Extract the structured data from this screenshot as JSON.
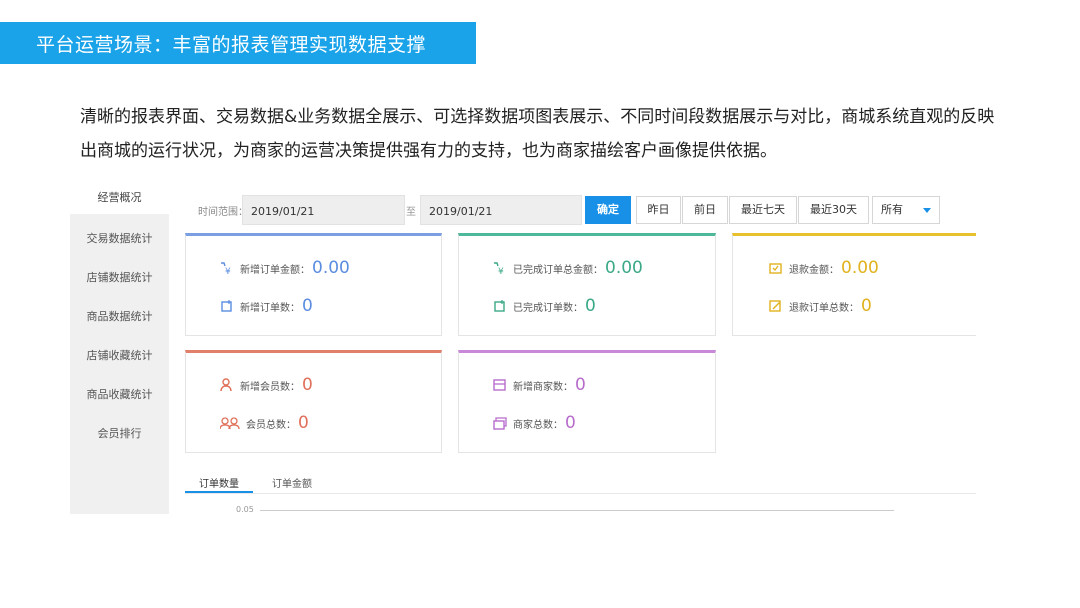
{
  "slide": {
    "title": "平台运营场景：丰富的报表管理实现数据支撑",
    "intro": "清晰的报表界面、交易数据&业务数据全展示、可选择数据项图表展示、不同时间段数据展示与对比，商城系统直观的反映出商城的运行状况，为商家的运营决策提供强有力的支持，也为商家描绘客户画像提供依据。"
  },
  "sidebar": {
    "items": [
      {
        "label": "经营概况"
      },
      {
        "label": "交易数据统计"
      },
      {
        "label": "店铺数据统计"
      },
      {
        "label": "商品数据统计"
      },
      {
        "label": "店铺收藏统计"
      },
      {
        "label": "商品收藏统计"
      },
      {
        "label": "会员排行"
      }
    ]
  },
  "filter": {
    "range_label": "时间范围：",
    "start_date": "2019/01/21",
    "to_label": "至",
    "end_date": "2019/01/21",
    "confirm": "确定",
    "buttons": [
      "昨日",
      "前日",
      "最近七天",
      "最近30天"
    ],
    "select_value": "所有"
  },
  "cards": [
    {
      "color": "#7b9fe0",
      "rows": [
        {
          "icon": "new-order-amount-icon",
          "label": "新增订单金额：",
          "value": "0.00"
        },
        {
          "icon": "new-order-count-icon",
          "label": "新增订单数：",
          "value": "0"
        }
      ]
    },
    {
      "color": "#4db89a",
      "rows": [
        {
          "icon": "completed-amount-icon",
          "label": "已完成订单总金额：",
          "value": "0.00"
        },
        {
          "icon": "completed-count-icon",
          "label": "已完成订单数：",
          "value": "0"
        }
      ]
    },
    {
      "color": "#e8c22e",
      "rows": [
        {
          "icon": "refund-amount-icon",
          "label": "退款金额：",
          "value": "0.00"
        },
        {
          "icon": "refund-count-icon",
          "label": "退款订单总数：",
          "value": "0"
        }
      ]
    },
    {
      "color": "#e0806a",
      "rows": [
        {
          "icon": "new-member-icon",
          "label": "新增会员数：",
          "value": "0"
        },
        {
          "icon": "member-total-icon",
          "label": "会员总数：",
          "value": "0"
        }
      ]
    },
    {
      "color": "#c88ad8",
      "rows": [
        {
          "icon": "new-merchant-icon",
          "label": "新增商家数：",
          "value": "0"
        },
        {
          "icon": "merchant-total-icon",
          "label": "商家总数：",
          "value": "0"
        }
      ]
    }
  ],
  "tabs": [
    {
      "label": "订单数量"
    },
    {
      "label": "订单金额"
    }
  ],
  "chart": {
    "y_tick": "0.05"
  }
}
